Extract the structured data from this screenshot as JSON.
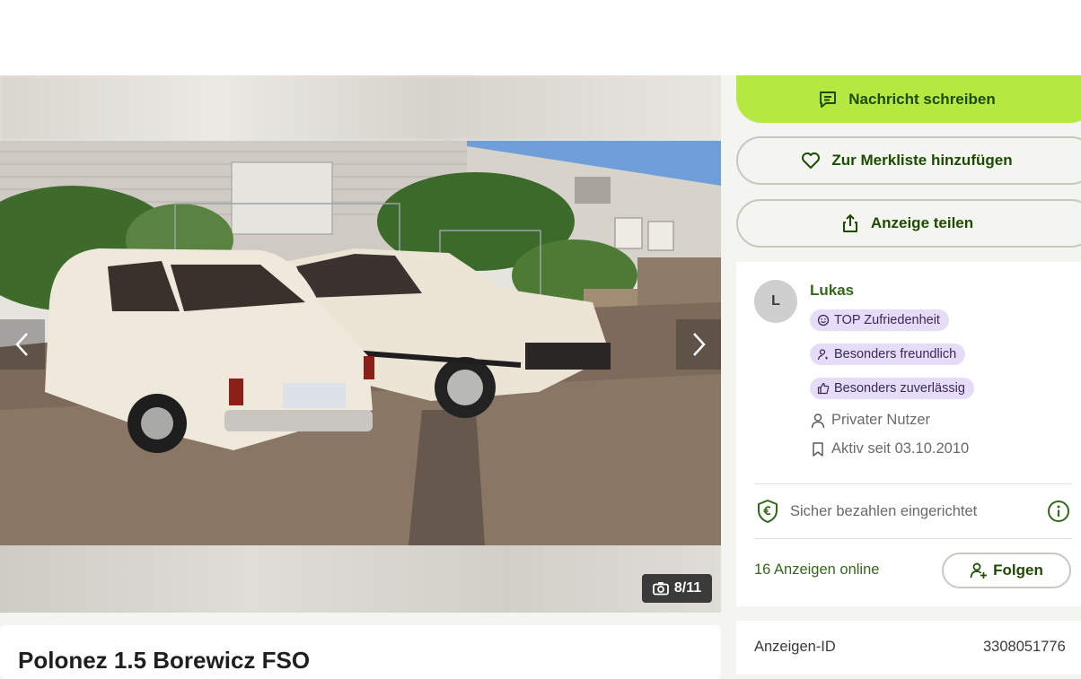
{
  "gallery": {
    "counter": "8/11",
    "prev_icon": "chevron-left-icon",
    "next_icon": "chevron-right-icon",
    "camera_icon": "camera-icon"
  },
  "listing": {
    "title": "Polonez 1.5 Borewicz FSO"
  },
  "actions": {
    "message_label": "Nachricht schreiben",
    "watchlist_label": "Zur Merkliste hinzufügen",
    "share_label": "Anzeige teilen"
  },
  "seller": {
    "avatar_initial": "L",
    "name": "Lukas",
    "badges": [
      {
        "label": "TOP Zufriedenheit",
        "icon": "smile-icon"
      },
      {
        "label": "Besonders freundlich",
        "icon": "friendly-user-icon"
      },
      {
        "label": "Besonders zuverlässig",
        "icon": "thumbs-up-icon"
      }
    ],
    "type": "Privater Nutzer",
    "active_since": "Aktiv seit 03.10.2010",
    "secure_payment": "Sicher bezahlen eingerichtet",
    "listings_online": "16 Anzeigen online",
    "follow_label": "Folgen"
  },
  "details": {
    "id_label": "Anzeigen-ID",
    "id_value": "3308051776"
  },
  "colors": {
    "accent_green": "#b5e941",
    "text_green": "#326916",
    "badge_purple": "#e7dcf7"
  }
}
